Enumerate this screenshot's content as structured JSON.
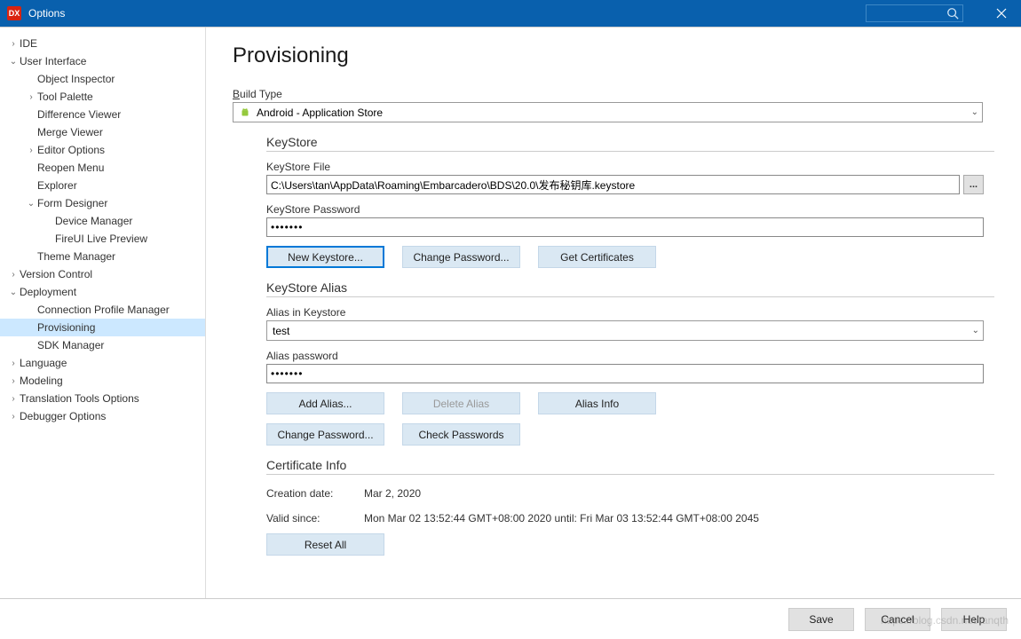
{
  "window": {
    "title": "Options",
    "app_badge": "DX"
  },
  "sidebar": {
    "items": [
      {
        "label": "IDE",
        "depth": 0,
        "chev": "right"
      },
      {
        "label": "User Interface",
        "depth": 0,
        "chev": "down"
      },
      {
        "label": "Object Inspector",
        "depth": 1
      },
      {
        "label": "Tool Palette",
        "depth": 1,
        "chev": "right"
      },
      {
        "label": "Difference Viewer",
        "depth": 1
      },
      {
        "label": "Merge Viewer",
        "depth": 1
      },
      {
        "label": "Editor Options",
        "depth": 1,
        "chev": "right"
      },
      {
        "label": "Reopen Menu",
        "depth": 1
      },
      {
        "label": "Explorer",
        "depth": 1
      },
      {
        "label": "Form Designer",
        "depth": 1,
        "chev": "down"
      },
      {
        "label": "Device Manager",
        "depth": 2
      },
      {
        "label": "FireUI Live Preview",
        "depth": 2
      },
      {
        "label": "Theme Manager",
        "depth": 1
      },
      {
        "label": "Version Control",
        "depth": 0,
        "chev": "right"
      },
      {
        "label": "Deployment",
        "depth": 0,
        "chev": "down"
      },
      {
        "label": "Connection Profile Manager",
        "depth": 1
      },
      {
        "label": "Provisioning",
        "depth": 1,
        "selected": true
      },
      {
        "label": "SDK Manager",
        "depth": 1
      },
      {
        "label": "Language",
        "depth": 0,
        "chev": "right"
      },
      {
        "label": "Modeling",
        "depth": 0,
        "chev": "right"
      },
      {
        "label": "Translation Tools Options",
        "depth": 0,
        "chev": "right"
      },
      {
        "label": "Debugger Options",
        "depth": 0,
        "chev": "right"
      }
    ]
  },
  "content": {
    "page_title": "Provisioning",
    "build_type_label": "Build Type",
    "build_type_value": "Android - Application Store",
    "keystore": {
      "group": "KeyStore",
      "file_label": "KeyStore File",
      "file_value": "C:\\Users\\tan\\AppData\\Roaming\\Embarcadero\\BDS\\20.0\\发布秘钥库.keystore",
      "pwd_label": "KeyStore Password",
      "pwd_value": "•••••••",
      "btn_new": "New Keystore...",
      "btn_change": "Change Password...",
      "btn_get": "Get Certificates"
    },
    "alias": {
      "group": "KeyStore Alias",
      "in_label": "Alias in Keystore",
      "in_value": "test",
      "pwd_label": "Alias password",
      "pwd_value": "•••••••",
      "btn_add": "Add Alias...",
      "btn_del": "Delete Alias",
      "btn_info": "Alias Info",
      "btn_change": "Change Password...",
      "btn_check": "Check Passwords"
    },
    "cert": {
      "group": "Certificate Info",
      "creation_label": "Creation date:",
      "creation_value": "Mar 2, 2020",
      "valid_label": "Valid since:",
      "valid_value": "Mon Mar 02 13:52:44 GMT+08:00 2020 until: Fri Mar 03 13:52:44 GMT+08:00 2045",
      "btn_reset": "Reset All"
    }
  },
  "footer": {
    "save": "Save",
    "cancel": "Cancel",
    "help": "Help"
  },
  "watermark": "https://blog.csdn.net/tanqth"
}
